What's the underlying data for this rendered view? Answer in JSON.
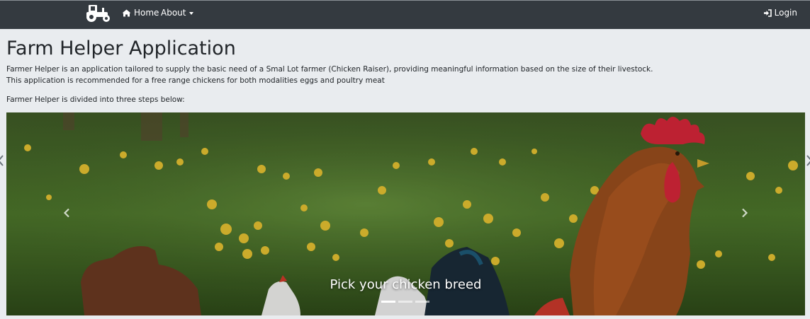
{
  "navbar": {
    "brand_icon": "tractor-icon",
    "home_label": "Home",
    "home_icon": "home-icon",
    "about_label": "About",
    "login_label": "Login",
    "login_icon": "sign-in-icon",
    "background": "#343a40"
  },
  "main": {
    "title": "Farm Helper Application",
    "description_line1": "Farmer Helper is an application tailored to supply the basic need of a Smal Lot farmer (Chicken Raiser), providing meaningful information based on the size of their livestock.",
    "description_line2": "This application is recommended for a free range chickens for both modalities eggs and poultry meat",
    "steps_intro": "Farmer Helper is divided into three steps below:"
  },
  "carousel": {
    "caption": "Pick your chicken breed",
    "indicators": 3,
    "active_index": 0,
    "prev_icon": "chevron-left-icon",
    "next_icon": "chevron-right-icon"
  }
}
